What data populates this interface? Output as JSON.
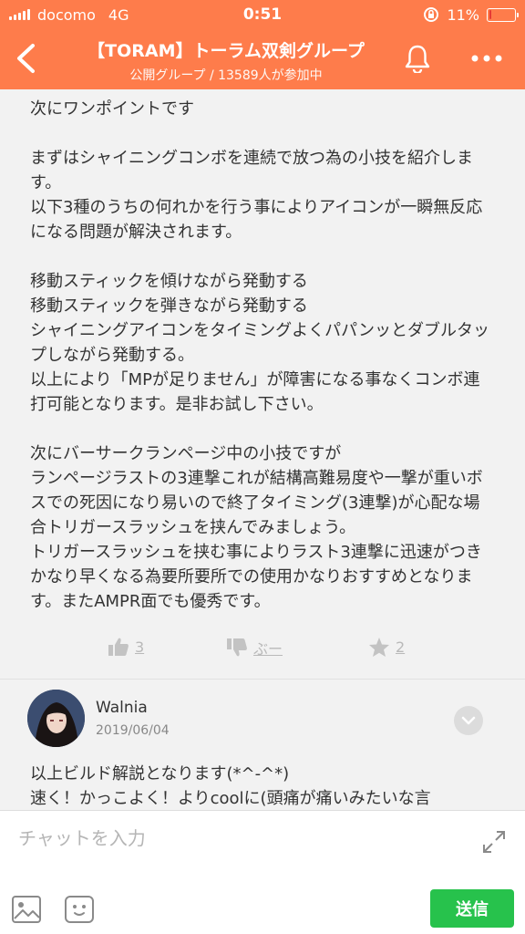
{
  "status_bar": {
    "carrier": "docomo",
    "network": "4G",
    "time": "0:51",
    "battery": "11%"
  },
  "header": {
    "title": "【TORAM】トーラム双剣グループ",
    "subtitle": "公開グループ / 13589人が参加中"
  },
  "post": {
    "body": "次にワンポイントです\n\nまずはシャイニングコンボを連続で放つ為の小技を紹介します。\n以下3種のうちの何れかを行う事によりアイコンが一瞬無反応になる問題が解決されます。\n\n移動スティックを傾けながら発動する\n移動スティックを弾きながら発動する\nシャイニングアイコンをタイミングよくパパンッとダブルタップしながら発動する。\n以上により「MPが足りません」が障害になる事なくコンボ連打可能となります。是非お試し下さい。\n\n次にバーサークランページ中の小技ですが\nランページラストの3連撃これが結構高難易度や一撃が重いボスでの死因になり易いので終了タイミング(3連撃)が心配な場合トリガースラッシュを挟んでみましょう。\nトリガースラッシュを挟む事によりラスト3連撃に迅速がつきかなり早くなる為要所要所での使用かなりおすすめとなります。またAMPR面でも優秀です。",
    "likes": "3",
    "dislike_label": "ぶー",
    "stars": "2"
  },
  "comment": {
    "author": "Walnia",
    "date": "2019/06/04",
    "text": "以上ビルド解説となります(*^-^*)\n速く！かっこよく！よりcoolに(頭痛が痛いみたいな言"
  },
  "input": {
    "placeholder": "チャットを入力",
    "send_label": "送信"
  }
}
